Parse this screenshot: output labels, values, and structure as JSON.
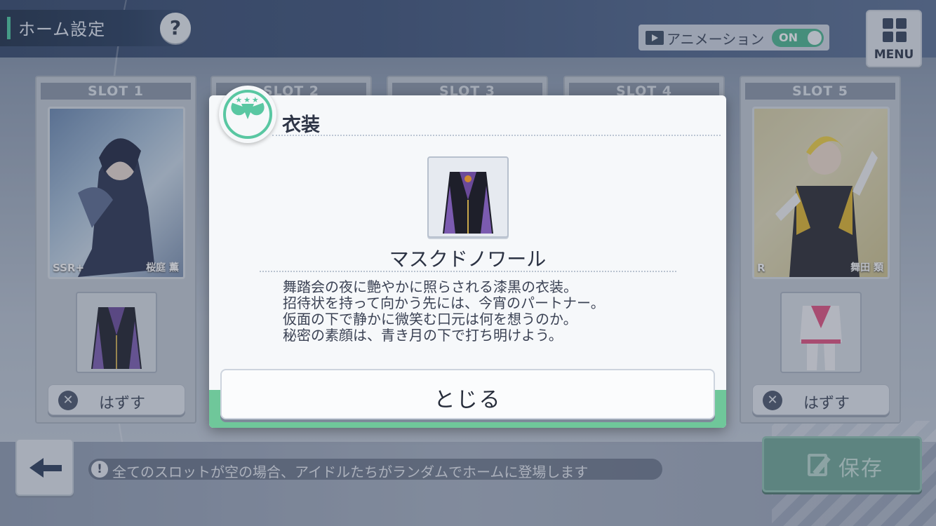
{
  "header": {
    "title": "ホーム設定",
    "help_icon": "?",
    "animation": {
      "label": "アニメーション",
      "state": "ON"
    },
    "menu_label": "MENU"
  },
  "slots": [
    {
      "label": "SLOT 1",
      "rarity": "SSR+",
      "idol_name": "桜庭 薫",
      "remove_label": "はずす"
    },
    {
      "label": "SLOT 2"
    },
    {
      "label": "SLOT 3"
    },
    {
      "label": "SLOT 4"
    },
    {
      "label": "SLOT 5",
      "rarity": "R",
      "idol_name": "舞田 類",
      "remove_label": "はずす"
    }
  ],
  "footer": {
    "notice_icon": "!",
    "notice": "全てのスロットが空の場合、アイドルたちがランダムでホームに登場します",
    "save_label": "保存"
  },
  "modal": {
    "title": "衣装",
    "item_name": "マスクドノワール",
    "description": [
      "舞踏会の夜に艶やかに照らされる漆黒の衣装。",
      "招待状を持って向かう先には、今宵のパートナー。",
      "仮面の下で静かに微笑む口元は何を想うのか。",
      "秘密の素顔は、青き月の下で打ち明けよう。"
    ],
    "close_label": "とじる"
  },
  "colors": {
    "accent_green": "#59c7a2",
    "toggle_on": "#4ab58e",
    "save_button": "#6fa796"
  }
}
